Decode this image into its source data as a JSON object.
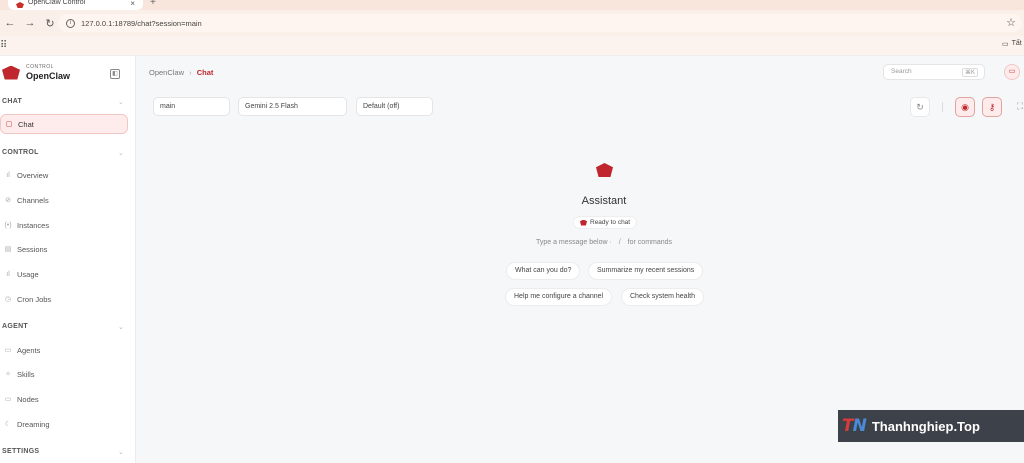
{
  "browser": {
    "tab_title": "OpenClaw Control",
    "tab_close": "×",
    "new_tab": "+",
    "url": "127.0.0.1:18789/chat?session=main",
    "bookmark_folder": "Tất"
  },
  "sidebar": {
    "brand_sub": "CONTROL",
    "brand_name": "OpenClaw",
    "sections": {
      "chat": "CHAT",
      "control": "CONTROL",
      "agent": "AGENT",
      "settings": "SETTINGS"
    },
    "items": {
      "chat": "Chat",
      "overview": "Overview",
      "channels": "Channels",
      "instances": "Instances",
      "sessions": "Sessions",
      "usage": "Usage",
      "cron_jobs": "Cron Jobs",
      "agents": "Agents",
      "skills": "Skills",
      "nodes": "Nodes",
      "dreaming": "Dreaming"
    }
  },
  "header": {
    "crumb_root": "OpenClaw",
    "crumb_sep": "›",
    "crumb_current": "Chat",
    "search_placeholder": "Search",
    "search_kbd": "⌘K"
  },
  "controls": {
    "session": "main",
    "model": "Gemini 2.5 Flash",
    "thinking": "Default (off)"
  },
  "empty_state": {
    "title": "Assistant",
    "status": "Ready to chat",
    "hint_left": "Type a message below ·",
    "hint_slash": "/",
    "hint_right": "for commands"
  },
  "suggestions": [
    "What can you do?",
    "Summarize my recent sessions",
    "Help me configure a channel",
    "Check system health"
  ],
  "watermark": {
    "logo_t": "T",
    "logo_n": "N",
    "text": "Thanhnghiep.Top"
  },
  "colors": {
    "accent": "#c0262d",
    "accent_bg": "#fdeceb"
  }
}
